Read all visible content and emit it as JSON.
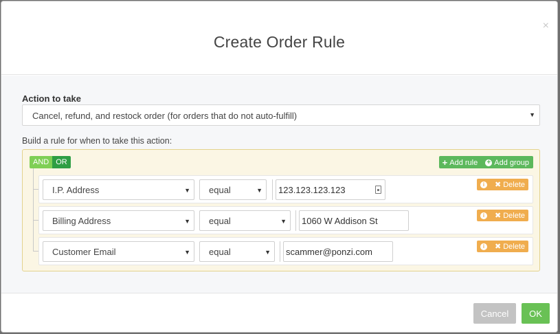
{
  "modal": {
    "title": "Create Order Rule",
    "close_glyph": "×"
  },
  "action": {
    "label": "Action to take",
    "selected": "Cancel, refund, and restock order (for orders that do not auto-fulfill)"
  },
  "builder": {
    "label": "Build a rule for when to take this action:",
    "logic": {
      "and_label": "AND",
      "or_label": "OR",
      "active": "OR"
    },
    "add_rule_label": "Add rule",
    "add_group_label": "Add group",
    "rules": [
      {
        "field": "I.P. Address",
        "operator": "equal",
        "value": "123.123.123.123",
        "delete_label": "Delete"
      },
      {
        "field": "Billing Address",
        "operator": "equal",
        "value": "1060 W Addison St",
        "delete_label": "Delete"
      },
      {
        "field": "Customer Email",
        "operator": "equal",
        "value": "scammer@ponzi.com",
        "delete_label": "Delete"
      }
    ]
  },
  "footer": {
    "cancel_label": "Cancel",
    "ok_label": "OK"
  },
  "colors": {
    "primary_green": "#5cb85c",
    "ok_green": "#69c155",
    "warning_orange": "#f0ad4e",
    "builder_bg": "#fbf6e4",
    "cancel_grey": "#c3c3c3"
  },
  "icons": [
    "close-icon",
    "dropdown-caret-icon",
    "plus-icon",
    "plus-circle-icon",
    "info-icon",
    "times-icon",
    "clipboard-icon"
  ]
}
